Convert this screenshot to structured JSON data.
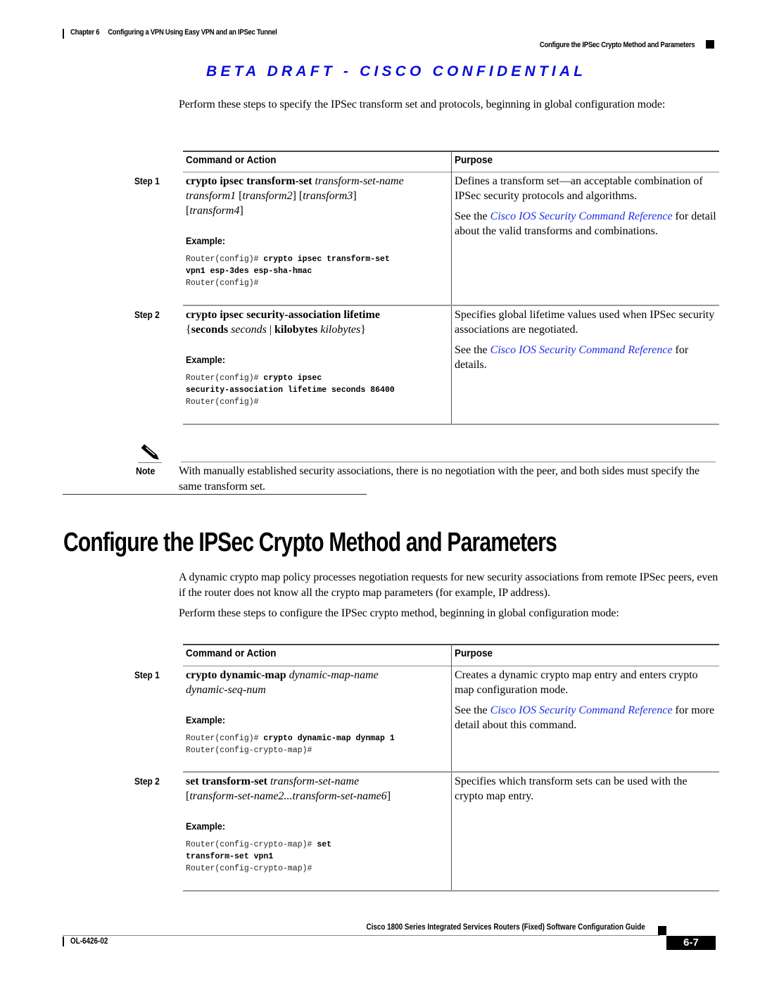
{
  "header": {
    "chapter_label": "Chapter 6",
    "chapter_title": "Configuring a VPN Using Easy VPN and an IPSec Tunnel",
    "section_title": "Configure the IPSec Crypto Method and Parameters",
    "watermark": "BETA DRAFT - CISCO CONFIDENTIAL",
    "watermark_color": "#0a10d8"
  },
  "intro1": "Perform these steps to specify the IPSec transform set and protocols, beginning in global configuration mode:",
  "table1": {
    "col_command": "Command or Action",
    "col_purpose": "Purpose",
    "rows": [
      {
        "step": "Step 1",
        "cmd_bold": "crypto ipsec transform-set",
        "cmd_italic": "transform-set-name",
        "cmd_line2_a": "transform1",
        "cmd_line2_b": "[",
        "cmd_line2_c": "transform2",
        "cmd_line2_d": "] [",
        "cmd_line2_e": "transform3",
        "cmd_line2_f": "]",
        "cmd_line3_open": "[",
        "cmd_line3_italic": "transform4",
        "cmd_line3_close": "]",
        "example_label": "Example:",
        "code_l1_prompt": "Router(config)# ",
        "code_l1_bold": "crypto ipsec transform-set",
        "code_l2_bold": "vpn1 esp-3des esp-sha-hmac",
        "code_l3": "Router(config)#",
        "purpose_text": "Defines a transform set—an acceptable combination of IPSec security protocols and algorithms.",
        "purpose_see": "See the ",
        "purpose_link": "Cisco IOS Security Command Reference",
        "purpose_after": " for detail about the valid transforms and combinations."
      },
      {
        "step": "Step 2",
        "cmd_bold": "crypto ipsec security-association lifetime",
        "cmd_l2_open": "{",
        "cmd_l2_b1": "seconds",
        "cmd_l2_i1": "seconds",
        "cmd_l2_sep": " | ",
        "cmd_l2_b2": "kilobytes",
        "cmd_l2_i2": "kilobytes",
        "cmd_l2_close": "}",
        "example_label": "Example:",
        "code_l1_prompt": "Router(config)# ",
        "code_l1_bold": "crypto ipsec",
        "code_l2_bold": "security-association lifetime seconds 86400",
        "code_l3": "Router(config)#",
        "purpose_text": "Specifies global lifetime values used when IPSec security associations are negotiated.",
        "purpose_see": "See the ",
        "purpose_link": "Cisco IOS Security Command Reference",
        "purpose_after": " for details."
      }
    ]
  },
  "note": {
    "label": "Note",
    "text": "With manually established security associations, there is no negotiation with the peer, and both sides must specify the same transform set."
  },
  "section_heading": "Configure the IPSec Crypto Method and Parameters",
  "intro2": "A dynamic crypto map policy processes negotiation requests for new security associations from remote IPSec peers, even if the router does not know all the crypto map parameters (for example, IP address).",
  "intro3": "Perform these steps to configure the IPSec crypto method, beginning in global configuration mode:",
  "table2": {
    "col_command": "Command or Action",
    "col_purpose": "Purpose",
    "rows": [
      {
        "step": "Step 1",
        "cmd_bold": "crypto dynamic-map",
        "cmd_italic": "dynamic-map-name",
        "cmd_line2_italic": "dynamic-seq-num",
        "example_label": "Example:",
        "code_l1_prompt": "Router(config)# ",
        "code_l1_bold": "crypto dynamic-map dynmap 1",
        "code_l2": "Router(config-crypto-map)#",
        "purpose_text": "Creates a dynamic crypto map entry and enters crypto map configuration mode.",
        "purpose_see": "See the ",
        "purpose_link": "Cisco IOS Security Command Reference",
        "purpose_after": " for more detail about this command."
      },
      {
        "step": "Step 2",
        "cmd_bold": "set transform-set",
        "cmd_italic": "transform-set-name",
        "cmd_l2_open": "[",
        "cmd_l2_italic": "transform-set-name2...transform-set-name6",
        "cmd_l2_close": "]",
        "example_label": "Example:",
        "code_l1_prompt": "Router(config-crypto-map)# ",
        "code_l1_bold": "set",
        "code_l2_bold": "transform-set vpn1",
        "code_l3": "Router(config-crypto-map)#",
        "purpose_text": "Specifies which transform sets can be used with the crypto map entry."
      }
    ]
  },
  "footer": {
    "guide_title": "Cisco 1800 Series Integrated Services Routers (Fixed) Software Configuration Guide",
    "doc_number": "OL-6426-02",
    "page_number": "6-7"
  },
  "colors": {
    "link": "#1a2ee8"
  }
}
